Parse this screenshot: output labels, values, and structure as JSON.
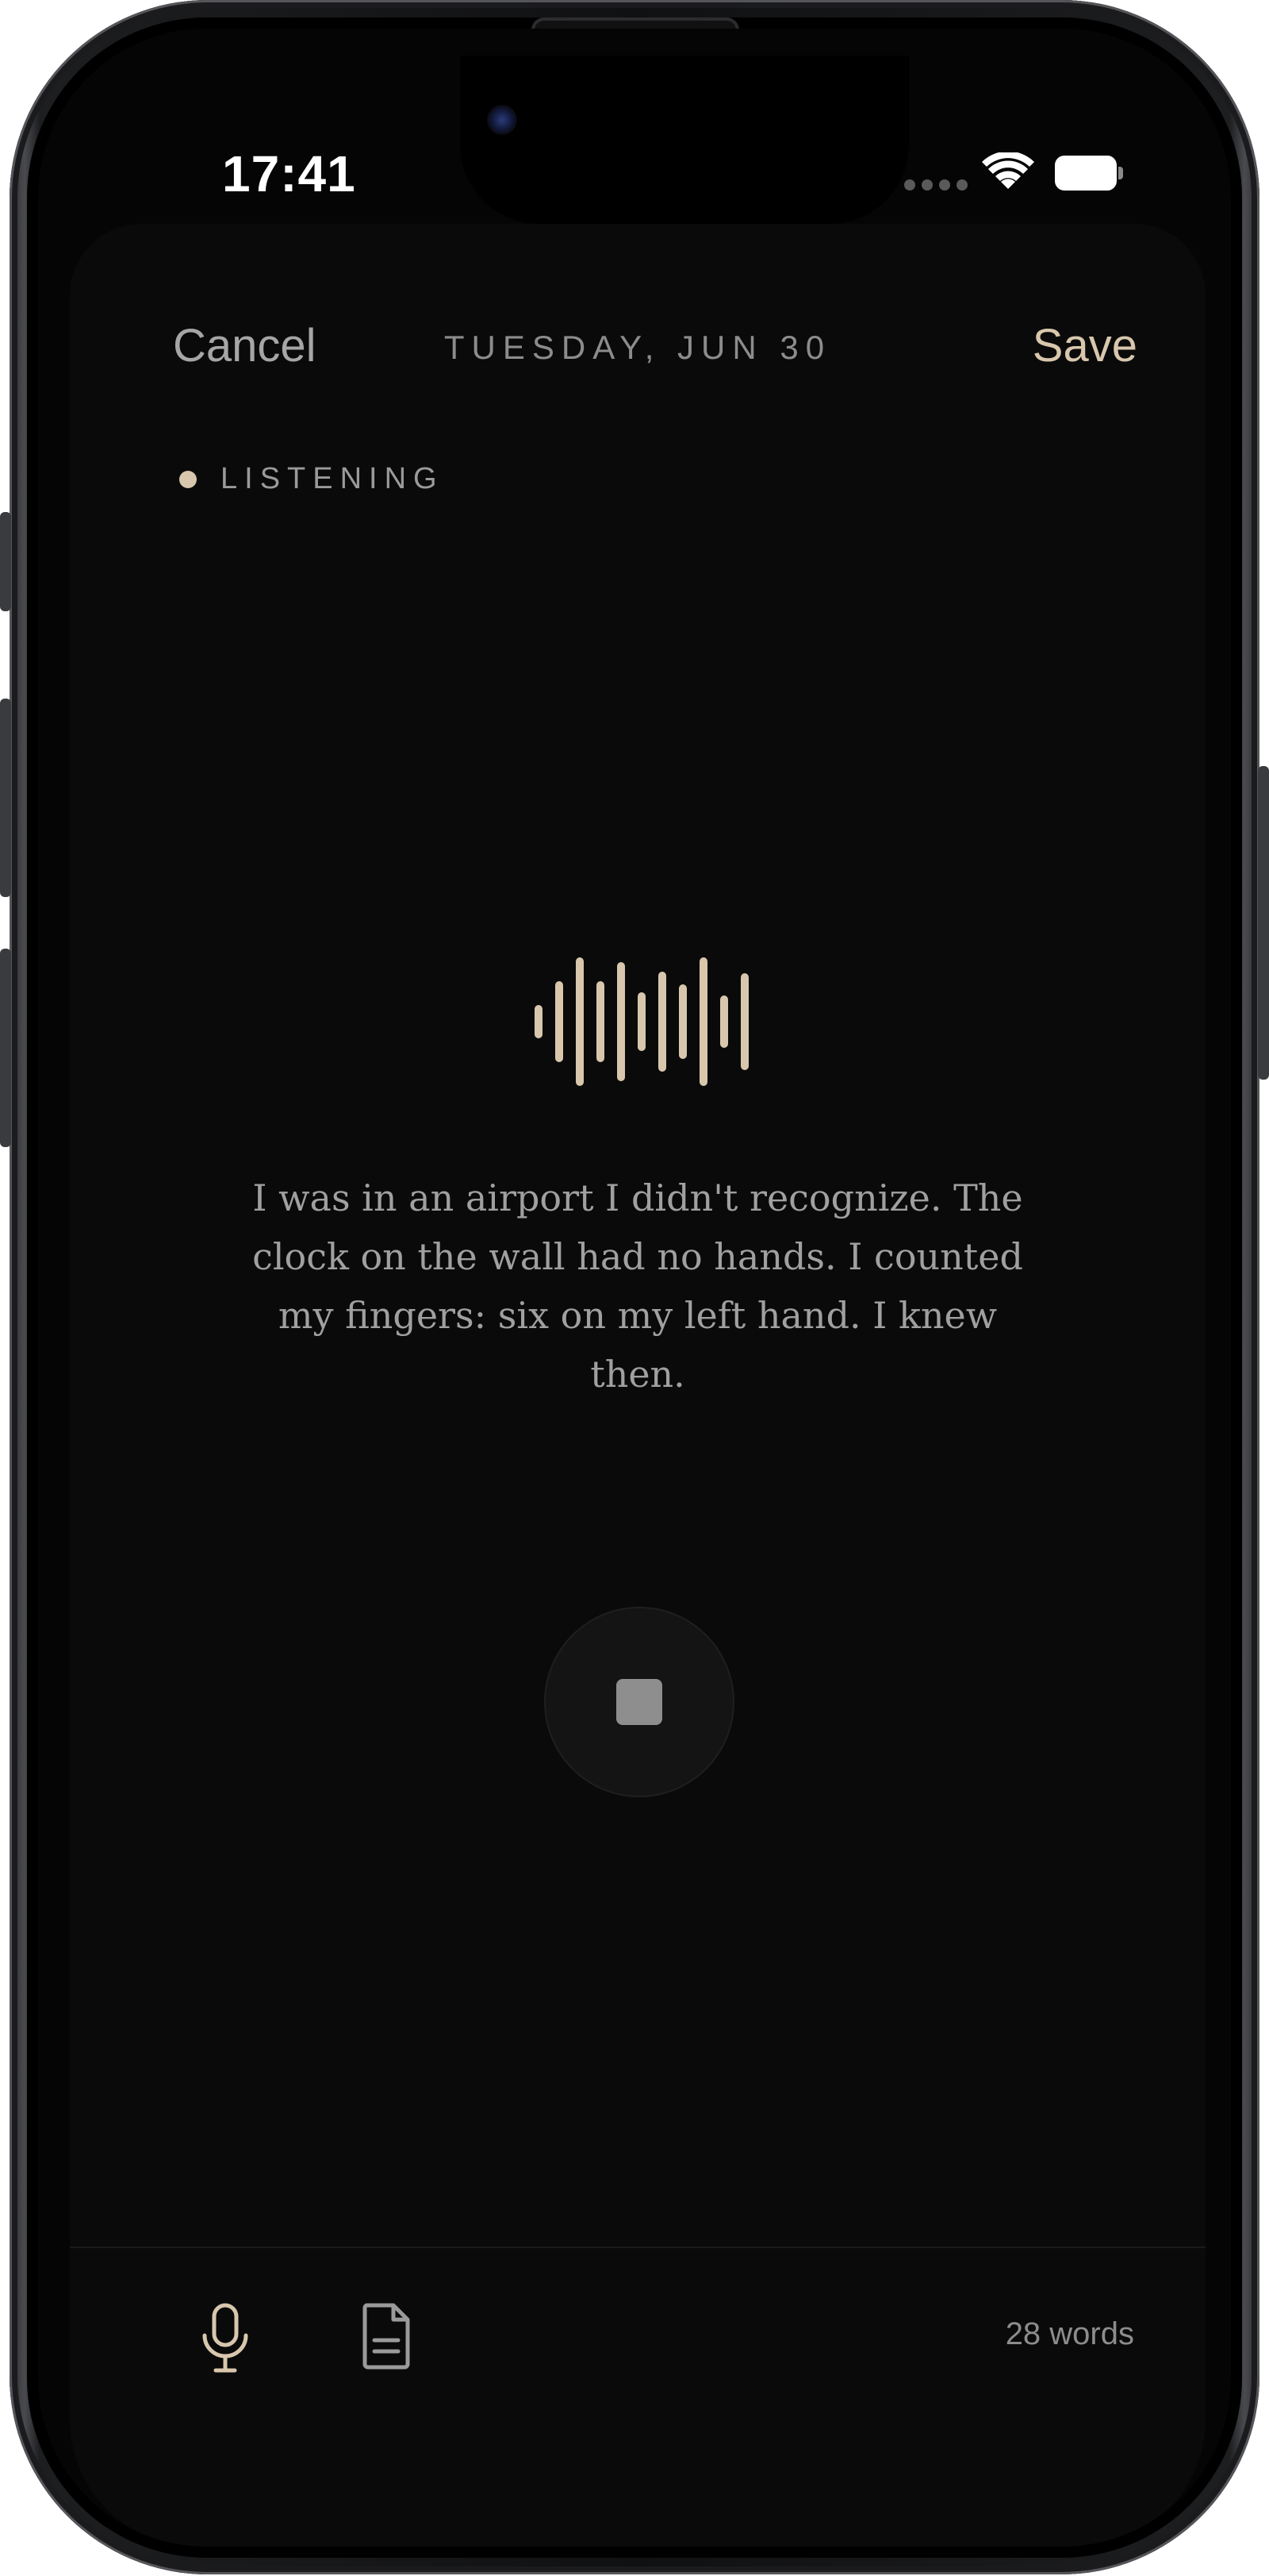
{
  "status_bar": {
    "time": "17:41",
    "icons": [
      "signal-dots-icon",
      "wifi-icon",
      "battery-icon"
    ]
  },
  "nav": {
    "cancel_label": "Cancel",
    "date": "TUESDAY, JUN 30",
    "save_label": "Save"
  },
  "recording": {
    "status_label": "LISTENING",
    "transcript": "I was in an airport I didn't recognize. The clock on the wall had no hands. I counted my fingers: six on my left hand. I knew then.",
    "stop_icon": "stop-icon"
  },
  "toolbar": {
    "mic_icon": "microphone-icon",
    "document_icon": "document-icon",
    "word_count": "28 words"
  },
  "colors": {
    "accent": "#d8c7ad",
    "background": "#0a0a0a",
    "text_muted": "#a0a0a0"
  }
}
